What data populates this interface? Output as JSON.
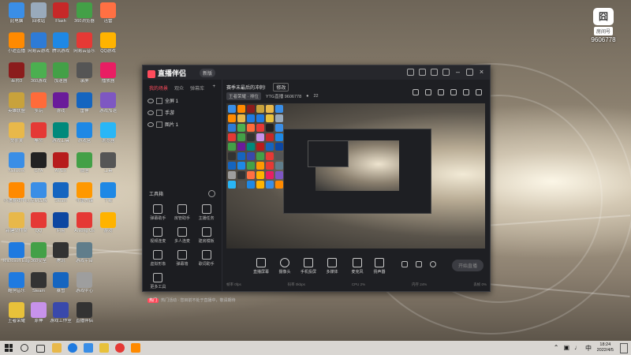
{
  "watermark": {
    "logo": "囧",
    "tag": "房间号",
    "number": "9606778"
  },
  "desktop_icons": [
    {
      "label": "此电脑",
      "color": "#3a8ee6"
    },
    {
      "label": "小迪直播",
      "color": "#ff8a00"
    },
    {
      "label": "巫师3",
      "color": "#8b1c1c"
    },
    {
      "label": "英雄联盟",
      "color": "#c8a23c"
    },
    {
      "label": "文件夹",
      "color": "#e8b84a"
    },
    {
      "label": "Network",
      "color": "#3a8ee6"
    },
    {
      "label": "小迪游戏中心",
      "color": "#ff8a00"
    },
    {
      "label": "新建文件夹",
      "color": "#e8b84a"
    },
    {
      "label": "Microsoft Edge",
      "color": "#1f7ae0"
    },
    {
      "label": "酷狗音乐",
      "color": "#1f7ae0"
    },
    {
      "label": "王者荣耀",
      "color": "#e8c13a"
    },
    {
      "label": "回收站",
      "color": "#9ab"
    },
    {
      "label": "网易云游戏",
      "color": "#2e7bd6"
    },
    {
      "label": "360游戏",
      "color": "#4caf50"
    },
    {
      "label": "多玩",
      "color": "#ff6b3a"
    },
    {
      "label": "拳头",
      "color": "#e53935"
    },
    {
      "label": "GTA",
      "color": "#222"
    },
    {
      "label": "控制面板",
      "color": "#3a8ee6"
    },
    {
      "label": "QQ",
      "color": "#e53935"
    },
    {
      "label": "360安全",
      "color": "#43a047"
    },
    {
      "label": "Steam",
      "color": "#333"
    },
    {
      "label": "原神",
      "color": "#c792ea"
    },
    {
      "label": "Flash",
      "color": "#c62828"
    },
    {
      "label": "腾讯游戏",
      "color": "#1e88e5"
    },
    {
      "label": "加速器",
      "color": "#43a047"
    },
    {
      "label": "游戏",
      "color": "#6a1b9a"
    },
    {
      "label": "游戏工具",
      "color": "#00897b"
    },
    {
      "label": "APEX",
      "color": "#b71c1c"
    },
    {
      "label": "Steam",
      "color": "#1565c0"
    },
    {
      "label": "网易",
      "color": "#0d47a1"
    },
    {
      "label": "腾讯",
      "color": "#333"
    },
    {
      "label": "暴雪",
      "color": "#1565c0"
    },
    {
      "label": "游戏工作室",
      "color": "#3949ab"
    },
    {
      "label": "360浏览器",
      "color": "#43a047"
    },
    {
      "label": "网易云音乐",
      "color": "#e53935"
    },
    {
      "label": "录屏",
      "color": "#555"
    },
    {
      "label": "雷神",
      "color": "#1565c0"
    },
    {
      "label": "游戏盒",
      "color": "#1e88e5"
    },
    {
      "label": "微信",
      "color": "#43a047"
    },
    {
      "label": "守望先锋",
      "color": "#ff9800"
    },
    {
      "label": "Among Us",
      "color": "#e53935"
    },
    {
      "label": "游戏平台",
      "color": "#607d8b"
    },
    {
      "label": "游戏中心",
      "color": "#9e9e9e"
    },
    {
      "label": "直播伴侣",
      "color": "#333"
    },
    {
      "label": "迅雷",
      "color": "#ff7043"
    },
    {
      "label": "QQ游戏",
      "color": "#ffb300"
    },
    {
      "label": "播放器",
      "color": "#e91e63"
    },
    {
      "label": "游戏加速",
      "color": "#7e57c2"
    },
    {
      "label": "浏览器",
      "color": "#29b6f6"
    },
    {
      "label": "工具",
      "color": "#555"
    },
    {
      "label": "下载",
      "color": "#1e88e5"
    },
    {
      "label": "游戏",
      "color": "#ffb300"
    }
  ],
  "app": {
    "title": "直播伴侣",
    "version": "新版",
    "left_tabs": [
      "我的场景",
      "观众",
      "弹幕库"
    ],
    "scenes": [
      "全屏 1",
      "手游",
      "图片 1"
    ],
    "tools_title": "工具箱",
    "tools": [
      "弹幕助手",
      "房管助手",
      "主播任务",
      "视频连麦",
      "多人连麦",
      "建房模板",
      "虚拟形象",
      "弹幕墙",
      "歌词助手",
      "更多工具"
    ],
    "notice_tag": "热门",
    "notice_text": "热门活动 · 您目前不处于直播中，敬请期待",
    "stream_title": "赛季末最后的冲刺!",
    "edit_label": "修改",
    "category": "王者荣耀 · 排位",
    "ytg_label": "YTG直播 9606778",
    "viewers": "22",
    "controls": [
      "直播屏幕",
      "摄像头",
      "手机投屏",
      "多媒体",
      "麦克风",
      "扬声器"
    ],
    "start_button": "开始直播",
    "status": [
      "帧率 0fps",
      "码率 0kbps",
      "CPU 2%",
      "内存 24%",
      "丢帧 0%"
    ]
  },
  "taskbar": {
    "time": "18:24",
    "date": "2022/4/5",
    "tray_icons": [
      "chevron-up-icon",
      "network-icon",
      "volume-icon",
      "ime-icon"
    ]
  }
}
